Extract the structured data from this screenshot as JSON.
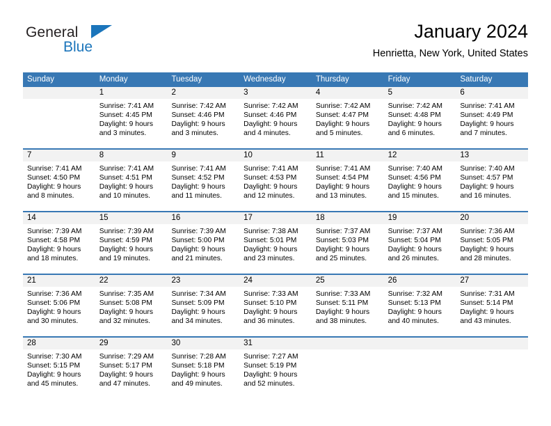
{
  "brand": {
    "name_part1": "General",
    "name_part2": "Blue",
    "flag_icon": "triangle-flag-icon"
  },
  "header": {
    "title": "January 2024",
    "subtitle": "Henrietta, New York, United States"
  },
  "theme": {
    "header_blue": "#3878b4",
    "brand_blue": "#1b75bb",
    "day_band_gray": "#f2f2f2"
  },
  "calendar": {
    "weekday_headers": [
      "Sunday",
      "Monday",
      "Tuesday",
      "Wednesday",
      "Thursday",
      "Friday",
      "Saturday"
    ],
    "weeks": [
      [
        {
          "day": "",
          "lines": []
        },
        {
          "day": "1",
          "lines": [
            "Sunrise: 7:41 AM",
            "Sunset: 4:45 PM",
            "Daylight: 9 hours",
            "and 3 minutes."
          ]
        },
        {
          "day": "2",
          "lines": [
            "Sunrise: 7:42 AM",
            "Sunset: 4:46 PM",
            "Daylight: 9 hours",
            "and 3 minutes."
          ]
        },
        {
          "day": "3",
          "lines": [
            "Sunrise: 7:42 AM",
            "Sunset: 4:46 PM",
            "Daylight: 9 hours",
            "and 4 minutes."
          ]
        },
        {
          "day": "4",
          "lines": [
            "Sunrise: 7:42 AM",
            "Sunset: 4:47 PM",
            "Daylight: 9 hours",
            "and 5 minutes."
          ]
        },
        {
          "day": "5",
          "lines": [
            "Sunrise: 7:42 AM",
            "Sunset: 4:48 PM",
            "Daylight: 9 hours",
            "and 6 minutes."
          ]
        },
        {
          "day": "6",
          "lines": [
            "Sunrise: 7:41 AM",
            "Sunset: 4:49 PM",
            "Daylight: 9 hours",
            "and 7 minutes."
          ]
        }
      ],
      [
        {
          "day": "7",
          "lines": [
            "Sunrise: 7:41 AM",
            "Sunset: 4:50 PM",
            "Daylight: 9 hours",
            "and 8 minutes."
          ]
        },
        {
          "day": "8",
          "lines": [
            "Sunrise: 7:41 AM",
            "Sunset: 4:51 PM",
            "Daylight: 9 hours",
            "and 10 minutes."
          ]
        },
        {
          "day": "9",
          "lines": [
            "Sunrise: 7:41 AM",
            "Sunset: 4:52 PM",
            "Daylight: 9 hours",
            "and 11 minutes."
          ]
        },
        {
          "day": "10",
          "lines": [
            "Sunrise: 7:41 AM",
            "Sunset: 4:53 PM",
            "Daylight: 9 hours",
            "and 12 minutes."
          ]
        },
        {
          "day": "11",
          "lines": [
            "Sunrise: 7:41 AM",
            "Sunset: 4:54 PM",
            "Daylight: 9 hours",
            "and 13 minutes."
          ]
        },
        {
          "day": "12",
          "lines": [
            "Sunrise: 7:40 AM",
            "Sunset: 4:56 PM",
            "Daylight: 9 hours",
            "and 15 minutes."
          ]
        },
        {
          "day": "13",
          "lines": [
            "Sunrise: 7:40 AM",
            "Sunset: 4:57 PM",
            "Daylight: 9 hours",
            "and 16 minutes."
          ]
        }
      ],
      [
        {
          "day": "14",
          "lines": [
            "Sunrise: 7:39 AM",
            "Sunset: 4:58 PM",
            "Daylight: 9 hours",
            "and 18 minutes."
          ]
        },
        {
          "day": "15",
          "lines": [
            "Sunrise: 7:39 AM",
            "Sunset: 4:59 PM",
            "Daylight: 9 hours",
            "and 19 minutes."
          ]
        },
        {
          "day": "16",
          "lines": [
            "Sunrise: 7:39 AM",
            "Sunset: 5:00 PM",
            "Daylight: 9 hours",
            "and 21 minutes."
          ]
        },
        {
          "day": "17",
          "lines": [
            "Sunrise: 7:38 AM",
            "Sunset: 5:01 PM",
            "Daylight: 9 hours",
            "and 23 minutes."
          ]
        },
        {
          "day": "18",
          "lines": [
            "Sunrise: 7:37 AM",
            "Sunset: 5:03 PM",
            "Daylight: 9 hours",
            "and 25 minutes."
          ]
        },
        {
          "day": "19",
          "lines": [
            "Sunrise: 7:37 AM",
            "Sunset: 5:04 PM",
            "Daylight: 9 hours",
            "and 26 minutes."
          ]
        },
        {
          "day": "20",
          "lines": [
            "Sunrise: 7:36 AM",
            "Sunset: 5:05 PM",
            "Daylight: 9 hours",
            "and 28 minutes."
          ]
        }
      ],
      [
        {
          "day": "21",
          "lines": [
            "Sunrise: 7:36 AM",
            "Sunset: 5:06 PM",
            "Daylight: 9 hours",
            "and 30 minutes."
          ]
        },
        {
          "day": "22",
          "lines": [
            "Sunrise: 7:35 AM",
            "Sunset: 5:08 PM",
            "Daylight: 9 hours",
            "and 32 minutes."
          ]
        },
        {
          "day": "23",
          "lines": [
            "Sunrise: 7:34 AM",
            "Sunset: 5:09 PM",
            "Daylight: 9 hours",
            "and 34 minutes."
          ]
        },
        {
          "day": "24",
          "lines": [
            "Sunrise: 7:33 AM",
            "Sunset: 5:10 PM",
            "Daylight: 9 hours",
            "and 36 minutes."
          ]
        },
        {
          "day": "25",
          "lines": [
            "Sunrise: 7:33 AM",
            "Sunset: 5:11 PM",
            "Daylight: 9 hours",
            "and 38 minutes."
          ]
        },
        {
          "day": "26",
          "lines": [
            "Sunrise: 7:32 AM",
            "Sunset: 5:13 PM",
            "Daylight: 9 hours",
            "and 40 minutes."
          ]
        },
        {
          "day": "27",
          "lines": [
            "Sunrise: 7:31 AM",
            "Sunset: 5:14 PM",
            "Daylight: 9 hours",
            "and 43 minutes."
          ]
        }
      ],
      [
        {
          "day": "28",
          "lines": [
            "Sunrise: 7:30 AM",
            "Sunset: 5:15 PM",
            "Daylight: 9 hours",
            "and 45 minutes."
          ]
        },
        {
          "day": "29",
          "lines": [
            "Sunrise: 7:29 AM",
            "Sunset: 5:17 PM",
            "Daylight: 9 hours",
            "and 47 minutes."
          ]
        },
        {
          "day": "30",
          "lines": [
            "Sunrise: 7:28 AM",
            "Sunset: 5:18 PM",
            "Daylight: 9 hours",
            "and 49 minutes."
          ]
        },
        {
          "day": "31",
          "lines": [
            "Sunrise: 7:27 AM",
            "Sunset: 5:19 PM",
            "Daylight: 9 hours",
            "and 52 minutes."
          ]
        },
        {
          "day": "",
          "lines": []
        },
        {
          "day": "",
          "lines": []
        },
        {
          "day": "",
          "lines": []
        }
      ]
    ]
  }
}
